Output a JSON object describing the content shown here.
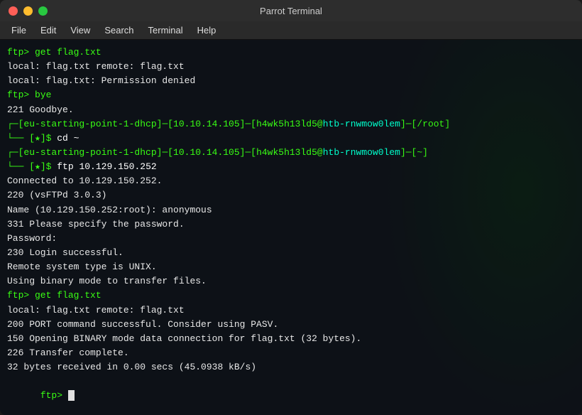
{
  "window": {
    "title": "Parrot Terminal",
    "traffic_lights": {
      "close": "close",
      "minimize": "minimize",
      "maximize": "maximize"
    }
  },
  "menubar": {
    "items": [
      "File",
      "Edit",
      "View",
      "Search",
      "Terminal",
      "Help"
    ]
  },
  "terminal": {
    "lines": [
      {
        "type": "ftp-output",
        "text": "ftp> get flag.txt"
      },
      {
        "type": "output",
        "text": "local: flag.txt remote: flag.txt"
      },
      {
        "type": "output",
        "text": "local: flag.txt: Permission denied"
      },
      {
        "type": "ftp-output",
        "text": "ftp> bye"
      },
      {
        "type": "output",
        "text": "221 Goodbye."
      },
      {
        "type": "prompt-line",
        "bracket_left": "┌─[",
        "label": "eu-starting-point-1-dhcp",
        "bracket_right": "]─[",
        "ip": "10.10.14.105",
        "br2": "]─[",
        "user": "h4wk5h13ld5",
        "at": "@",
        "host": "htb-rnwmow0lem",
        "br3": "]─[",
        "path": "/root",
        "br4": "]"
      },
      {
        "type": "prompt-cmd",
        "prefix": "└──",
        "star": "[★]$",
        "cmd": " cd ~"
      },
      {
        "type": "prompt-line",
        "bracket_left": "┌─[",
        "label": "eu-starting-point-1-dhcp",
        "bracket_right": "]─[",
        "ip": "10.10.14.105",
        "br2": "]─[",
        "user": "h4wk5h13ld5",
        "at": "@",
        "host": "htb-rnwmow0lem",
        "br3": "]─[",
        "path": "~",
        "br4": "]"
      },
      {
        "type": "prompt-cmd",
        "prefix": "└──",
        "star": "[★]$",
        "cmd": " ftp 10.129.150.252"
      },
      {
        "type": "output",
        "text": "Connected to 10.129.150.252."
      },
      {
        "type": "output",
        "text": "220 (vsFTPd 3.0.3)"
      },
      {
        "type": "output",
        "text": "Name (10.129.150.252:root): anonymous"
      },
      {
        "type": "output",
        "text": "331 Please specify the password."
      },
      {
        "type": "output",
        "text": "Password:"
      },
      {
        "type": "output",
        "text": "230 Login successful."
      },
      {
        "type": "output",
        "text": "Remote system type is UNIX."
      },
      {
        "type": "output",
        "text": "Using binary mode to transfer files."
      },
      {
        "type": "ftp-output",
        "text": "ftp> get flag.txt"
      },
      {
        "type": "output",
        "text": "local: flag.txt remote: flag.txt"
      },
      {
        "type": "output",
        "text": "200 PORT command successful. Consider using PASV."
      },
      {
        "type": "output",
        "text": "150 Opening BINARY mode data connection for flag.txt (32 bytes)."
      },
      {
        "type": "output",
        "text": "226 Transfer complete."
      },
      {
        "type": "output",
        "text": "32 bytes received in 0.00 secs (45.0938 kB/s)"
      },
      {
        "type": "ftp-prompt",
        "text": "ftp> "
      }
    ]
  }
}
